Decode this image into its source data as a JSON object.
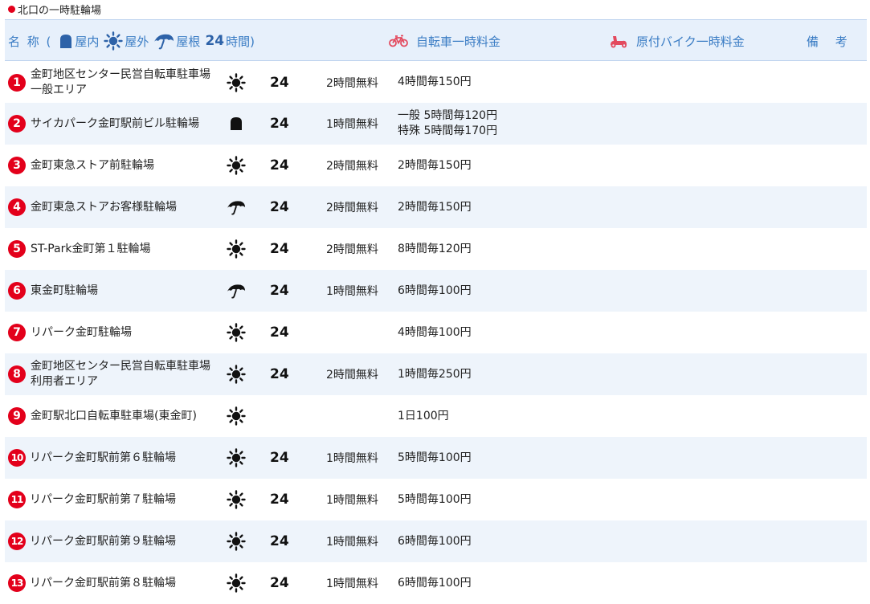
{
  "page": {
    "section_title": "北口の一時駐輪場"
  },
  "header": {
    "name_label": "名 称 (",
    "indoor_label": "屋内",
    "outdoor_label": "屋外",
    "roof_label": "屋根",
    "h24_label": "24",
    "hours_label": "時間)",
    "bicycle_fee_label": "自転車一時料金",
    "moped_fee_label": "原付バイク一時料金",
    "notes_label": "備 考"
  },
  "colors": {
    "accent_red": "#e3001b",
    "header_blue": "#3a7cc4",
    "row_alt": "#eef4fb"
  },
  "rows": [
    {
      "num": "1",
      "name": "金町地区センター民営自転車駐車場一般エリア",
      "type": "outdoor",
      "h24": "24",
      "free": "2時間無料",
      "fee": [
        "4時間毎150円"
      ]
    },
    {
      "num": "2",
      "name": "サイカパーク金町駅前ビル駐輪場",
      "type": "indoor",
      "h24": "24",
      "free": "1時間無料",
      "fee": [
        "一般 5時間毎120円",
        "特殊 5時間毎170円"
      ]
    },
    {
      "num": "3",
      "name": "金町東急ストア前駐輪場",
      "type": "outdoor",
      "h24": "24",
      "free": "2時間無料",
      "fee": [
        "2時間毎150円"
      ]
    },
    {
      "num": "4",
      "name": "金町東急ストアお客様駐輪場",
      "type": "roof",
      "h24": "24",
      "free": "2時間無料",
      "fee": [
        "2時間毎150円"
      ]
    },
    {
      "num": "5",
      "name": "ST-Park金町第１駐輪場",
      "type": "outdoor",
      "h24": "24",
      "free": "2時間無料",
      "fee": [
        "8時間毎120円"
      ]
    },
    {
      "num": "6",
      "name": "東金町駐輪場",
      "type": "roof",
      "h24": "24",
      "free": "1時間無料",
      "fee": [
        "6時間毎100円"
      ]
    },
    {
      "num": "7",
      "name": "リパーク金町駐輪場",
      "type": "outdoor",
      "h24": "24",
      "free": "",
      "fee": [
        "4時間毎100円"
      ]
    },
    {
      "num": "8",
      "name": "金町地区センター民営自転車駐車場利用者エリア",
      "type": "outdoor",
      "h24": "24",
      "free": "2時間無料",
      "fee": [
        "1時間毎250円"
      ]
    },
    {
      "num": "9",
      "name": "金町駅北口自転車駐車場(東金町)",
      "type": "outdoor",
      "h24": "",
      "free": "",
      "fee": [
        "1日100円"
      ]
    },
    {
      "num": "10",
      "name": "リパーク金町駅前第６駐輪場",
      "type": "outdoor",
      "h24": "24",
      "free": "1時間無料",
      "fee": [
        "5時間毎100円"
      ]
    },
    {
      "num": "11",
      "name": "リパーク金町駅前第７駐輪場",
      "type": "outdoor",
      "h24": "24",
      "free": "1時間無料",
      "fee": [
        "5時間毎100円"
      ]
    },
    {
      "num": "12",
      "name": "リパーク金町駅前第９駐輪場",
      "type": "outdoor",
      "h24": "24",
      "free": "1時間無料",
      "fee": [
        "6時間毎100円"
      ]
    },
    {
      "num": "13",
      "name": "リパーク金町駅前第８駐輪場",
      "type": "outdoor",
      "h24": "24",
      "free": "1時間無料",
      "fee": [
        "6時間毎100円"
      ]
    }
  ]
}
